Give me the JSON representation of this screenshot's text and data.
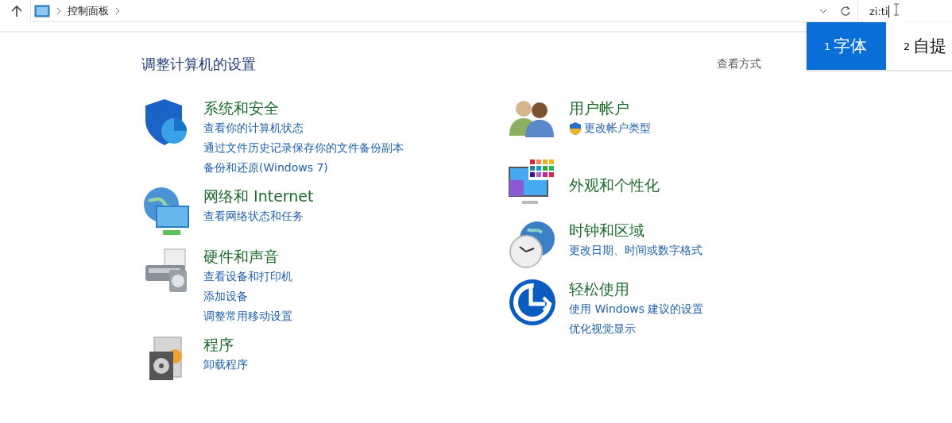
{
  "address_bar": {
    "breadcrumb": [
      "控制面板"
    ],
    "search_value": "zi:ti"
  },
  "ime_candidates": [
    {
      "number": "1",
      "text": "字体",
      "selected": true
    },
    {
      "number": "2",
      "text": "自提",
      "selected": false
    }
  ],
  "heading": "调整计算机的设置",
  "view_by_label": "查看方式",
  "columns": [
    [
      {
        "kind": "security",
        "title": "系统和安全",
        "links": [
          {
            "text": "查看你的计算机状态",
            "shield": false
          },
          {
            "text": "通过文件历史记录保存你的文件备份副本",
            "shield": false
          },
          {
            "text": "备份和还原(Windows 7)",
            "shield": false
          }
        ]
      },
      {
        "kind": "network",
        "title": "网络和 Internet",
        "links": [
          {
            "text": "查看网络状态和任务",
            "shield": false
          }
        ]
      },
      {
        "kind": "hardware",
        "title": "硬件和声音",
        "links": [
          {
            "text": "查看设备和打印机",
            "shield": false
          },
          {
            "text": "添加设备",
            "shield": false
          },
          {
            "text": "调整常用移动设置",
            "shield": false
          }
        ]
      },
      {
        "kind": "programs",
        "title": "程序",
        "links": [
          {
            "text": "卸载程序",
            "shield": false
          }
        ]
      }
    ],
    [
      {
        "kind": "users",
        "title": "用户帐户",
        "links": [
          {
            "text": "更改帐户类型",
            "shield": true
          }
        ]
      },
      {
        "kind": "appearance",
        "title": "外观和个性化"
      },
      {
        "kind": "clock",
        "title": "时钟和区域",
        "links": [
          {
            "text": "更改日期、时间或数字格式",
            "shield": false
          }
        ]
      },
      {
        "kind": "ease",
        "title": "轻松使用",
        "links": [
          {
            "text": "使用 Windows 建议的设置",
            "shield": false
          },
          {
            "text": "优化视觉显示",
            "shield": false
          }
        ]
      }
    ]
  ]
}
